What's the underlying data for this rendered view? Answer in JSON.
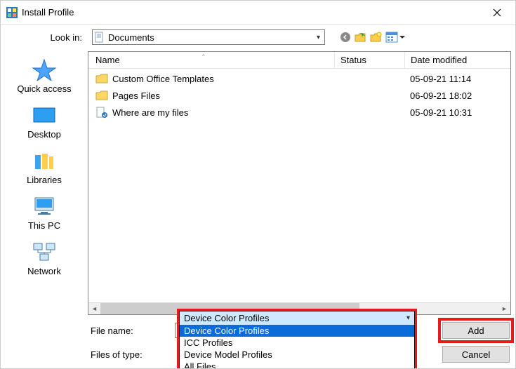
{
  "window": {
    "title": "Install Profile"
  },
  "lookin": {
    "label": "Look in:",
    "value": "Documents"
  },
  "places": {
    "quick_access": "Quick access",
    "desktop": "Desktop",
    "libraries": "Libraries",
    "this_pc": "This PC",
    "network": "Network"
  },
  "columns": {
    "name": "Name",
    "status": "Status",
    "date": "Date modified"
  },
  "files": [
    {
      "icon": "folder",
      "name": "Custom Office Templates",
      "status": "",
      "date": "05-09-21 11:14"
    },
    {
      "icon": "folder",
      "name": "Pages Files",
      "status": "",
      "date": "06-09-21 18:02"
    },
    {
      "icon": "link",
      "name": "Where are my files",
      "status": "",
      "date": "05-09-21 10:31"
    }
  ],
  "fileNameRow": {
    "label": "File name:",
    "value": ""
  },
  "filesOfTypeRow": {
    "label": "Files of type:",
    "value": "Device Color Profiles",
    "options": [
      "Device Color Profiles",
      "ICC Profiles",
      "Device Model Profiles",
      "All Files"
    ]
  },
  "buttons": {
    "add": "Add",
    "cancel": "Cancel"
  }
}
